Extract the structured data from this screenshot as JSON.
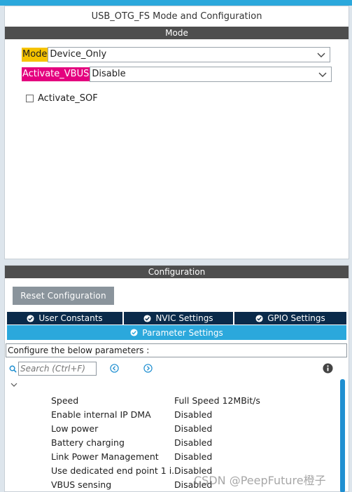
{
  "window": {
    "title": "USB_OTG_FS Mode and Configuration"
  },
  "mode_section": {
    "header": "Mode",
    "mode": {
      "label": "Mode",
      "value": "Device_Only"
    },
    "vbus": {
      "label": "Activate_VBUS",
      "value": "Disable"
    },
    "sof": {
      "label": "Activate_SOF",
      "checked": false
    }
  },
  "config_section": {
    "header": "Configuration",
    "reset_label": "Reset Configuration",
    "tabs": [
      {
        "label": "User Constants"
      },
      {
        "label": "NVIC Settings"
      },
      {
        "label": "GPIO Settings"
      }
    ],
    "active_tab": {
      "label": "Parameter Settings"
    },
    "configure_text": "Configure the below parameters :",
    "search": {
      "placeholder": "Search (Ctrl+F)"
    },
    "parameters": [
      {
        "name": "Speed",
        "value": "Full Speed 12MBit/s"
      },
      {
        "name": "Enable internal IP DMA",
        "value": "Disabled"
      },
      {
        "name": "Low power",
        "value": "Disabled"
      },
      {
        "name": "Battery charging",
        "value": "Disabled"
      },
      {
        "name": "Link Power Management",
        "value": "Disabled"
      },
      {
        "name": "Use dedicated end point 1 i...",
        "value": "Disabled"
      },
      {
        "name": "VBUS sensing",
        "value": "Disabled"
      }
    ]
  },
  "watermark": "CSDN @PeepFuture橙子",
  "colors": {
    "accent": "#2ba8dc",
    "tab_dark": "#0a2a4a",
    "mode_tag": "#f6c300",
    "vbus_tag": "#e4007f",
    "section_bar": "#4e4e4e"
  }
}
